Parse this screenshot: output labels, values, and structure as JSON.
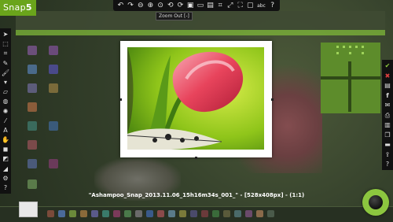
{
  "app": {
    "logo_text": "Snap",
    "logo_version": "5"
  },
  "colors": {
    "accent": "#8cc63f",
    "toolbar_bg": "#111111",
    "frame": "#ffffff"
  },
  "top_toolbar": {
    "icons": [
      "undo-icon",
      "redo-icon",
      "zoom-out-icon",
      "zoom-in-icon",
      "zoom-reset-icon",
      "rotate-left-icon",
      "rotate-right-icon",
      "fit-window-icon",
      "screen-icon",
      "image-icon",
      "crop-icon",
      "resize-icon",
      "fullscreen-icon",
      "frame-icon",
      "abc-text-icon",
      "help-icon"
    ],
    "tooltip": "Zoom Out [-]",
    "text_label": "abc"
  },
  "left_tools": [
    "pointer-icon",
    "select-icon",
    "crop-tool-icon",
    "pen-icon",
    "brush-icon",
    "fill-icon",
    "eraser-icon",
    "blur-icon",
    "spray-icon",
    "pipette-icon",
    "text-icon",
    "hand-icon",
    "stamp-icon",
    "shadow-icon",
    "gradient-icon",
    "settings-icon",
    "help-icon"
  ],
  "right_tools": [
    "confirm-icon",
    "close-icon",
    "save-icon",
    "facebook-icon",
    "email-icon",
    "print-icon",
    "delete-icon",
    "copy-icon",
    "folder-icon",
    "upload-icon",
    "help-icon"
  ],
  "caption": "\"Ashampoo_Snap_2013.11.06_15h16m34s_001_\" - [528x408px] - (1:1)"
}
